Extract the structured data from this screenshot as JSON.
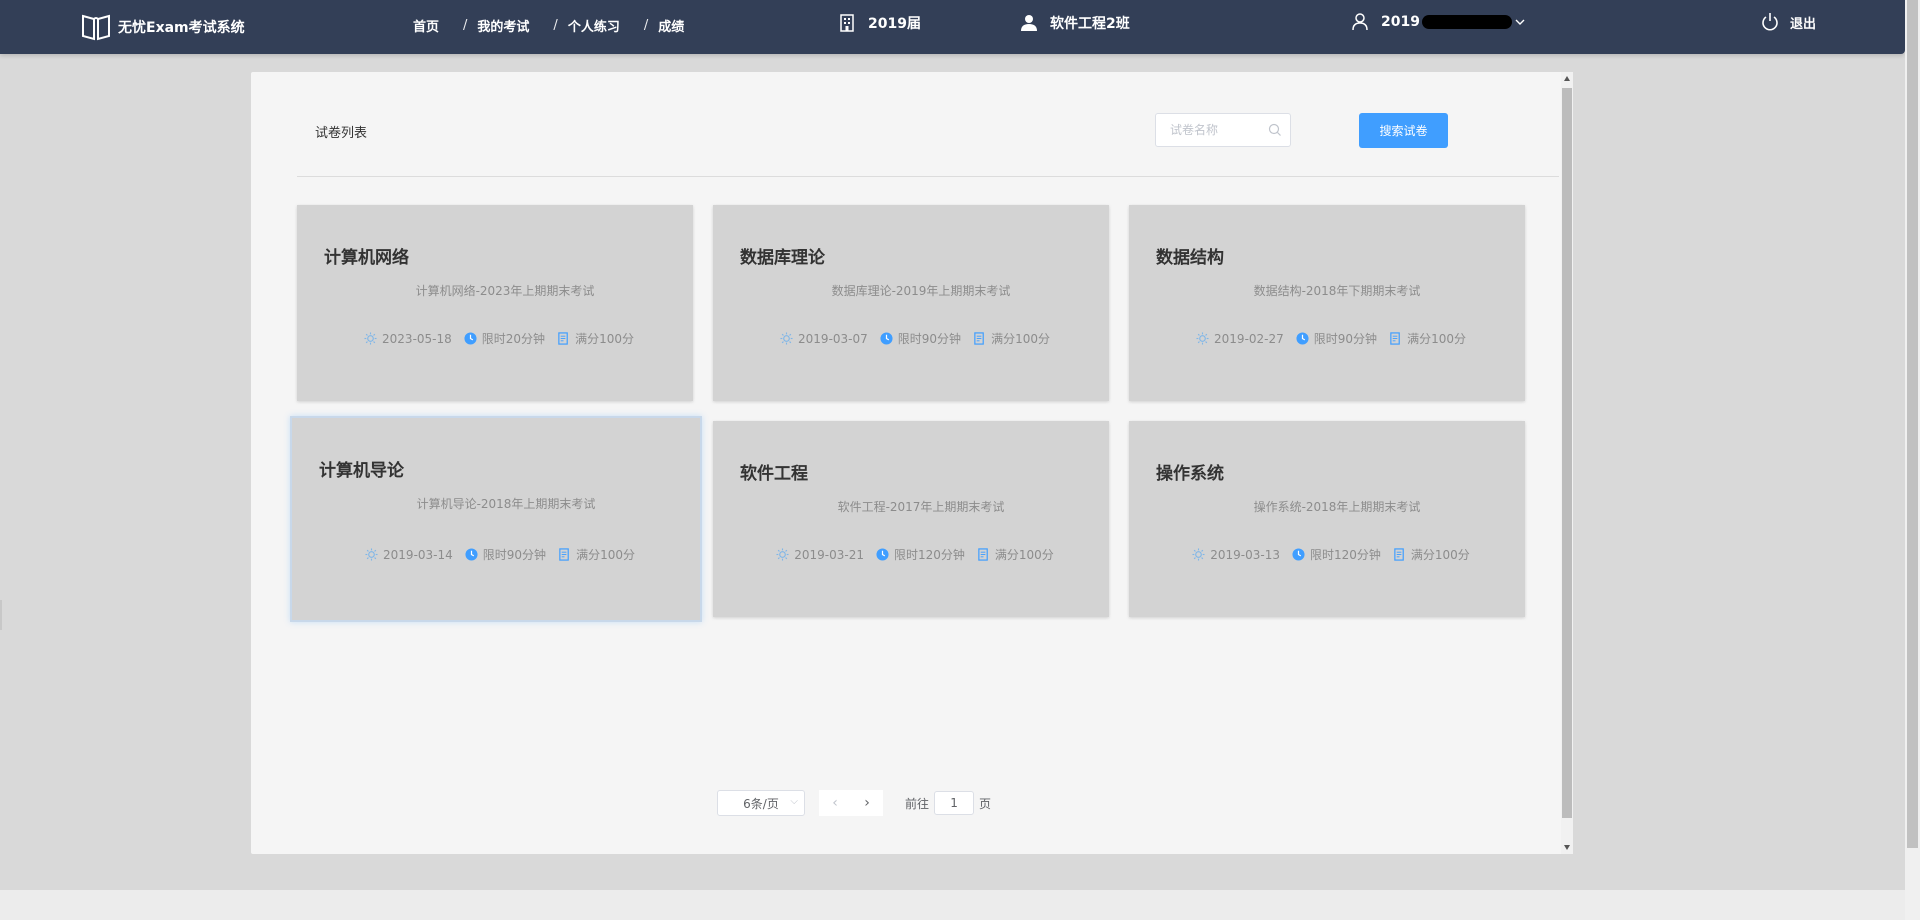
{
  "header": {
    "app_title": "无忧Exam考试系统",
    "nav": [
      {
        "label": "首页"
      },
      {
        "label": "我的考试"
      },
      {
        "label": "个人练习"
      },
      {
        "label": "成绩"
      }
    ],
    "separator": "/",
    "grade": "2019届",
    "class_name": "软件工程2班",
    "user_id_prefix": "2019",
    "logout_label": "退出"
  },
  "panel": {
    "title": "试卷列表",
    "search_placeholder": "试卷名称",
    "search_button": "搜索试卷"
  },
  "exams": [
    {
      "name": "计算机网络",
      "desc": "计算机网络-2023年上期期末考试",
      "date": "2023-05-18",
      "limit": "限时20分钟",
      "score": "满分100分"
    },
    {
      "name": "数据库理论",
      "desc": "数据库理论-2019年上期期末考试",
      "date": "2019-03-07",
      "limit": "限时90分钟",
      "score": "满分100分"
    },
    {
      "name": "数据结构",
      "desc": "数据结构-2018年下期期末考试",
      "date": "2019-02-27",
      "limit": "限时90分钟",
      "score": "满分100分"
    },
    {
      "name": "计算机导论",
      "desc": "计算机导论-2018年上期期末考试",
      "date": "2019-03-14",
      "limit": "限时90分钟",
      "score": "满分100分"
    },
    {
      "name": "软件工程",
      "desc": "软件工程-2017年上期期末考试",
      "date": "2019-03-21",
      "limit": "限时120分钟",
      "score": "满分100分"
    },
    {
      "name": "操作系统",
      "desc": "操作系统-2018年上期期末考试",
      "date": "2019-03-13",
      "limit": "限时120分钟",
      "score": "满分100分"
    }
  ],
  "pagination": {
    "page_size": "6条/页",
    "goto_prefix": "前往",
    "current_page": "1",
    "goto_suffix": "页"
  },
  "colors": {
    "header_bg": "#333f57",
    "primary": "#409eff",
    "card_bg": "#d3d3d3"
  }
}
